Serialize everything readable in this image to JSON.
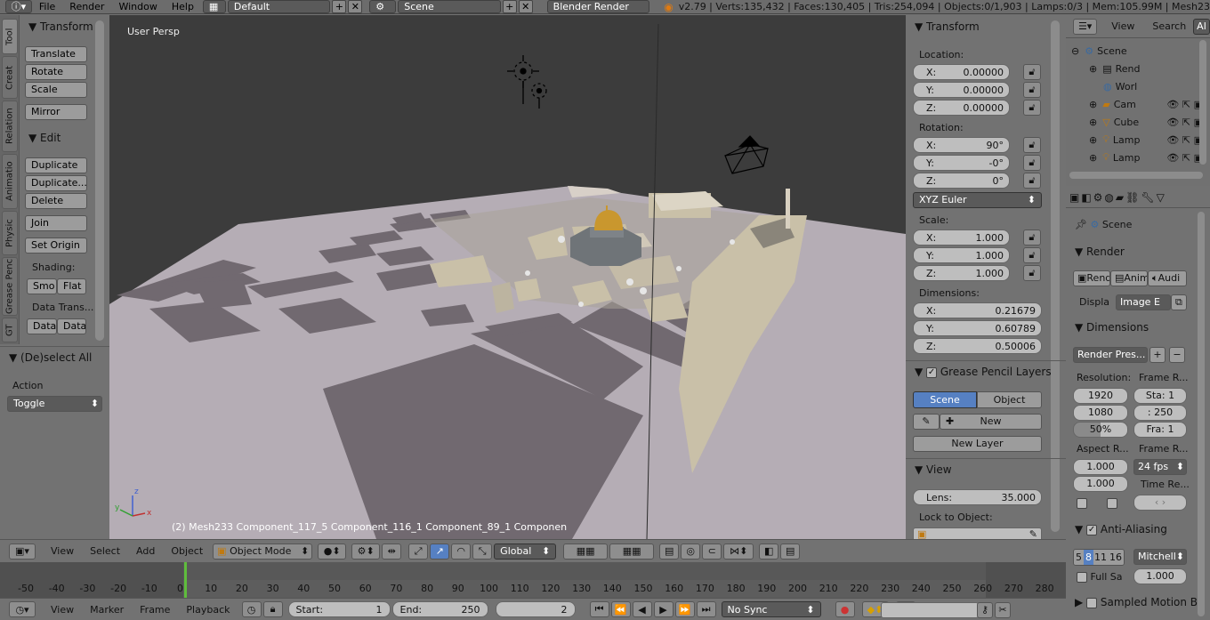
{
  "topbar": {
    "menus": [
      "File",
      "Render",
      "Window",
      "Help"
    ],
    "screen_layout": "Default",
    "scene": "Scene",
    "render_engine": "Blender Render",
    "stats": "v2.79 | Verts:135,432 | Faces:130,405 | Tris:254,094 | Objects:0/1,903 | Lamps:0/3 | Mem:105.99M | Mesh23"
  },
  "toolshelf": {
    "tabs": [
      "Tool",
      "Creat",
      "Relation",
      "Animatio",
      "Physic",
      "Grease Penc",
      "GT"
    ],
    "transform_header": "Transform",
    "translate": "Translate",
    "rotate": "Rotate",
    "scale": "Scale",
    "mirror": "Mirror",
    "edit_header": "Edit",
    "duplicate": "Duplicate",
    "duplicate_linked": "Duplicate...",
    "delete": "Delete",
    "join": "Join",
    "set_origin": "Set Origin",
    "shading_label": "Shading:",
    "smooth": "Smo",
    "flat": "Flat",
    "data_transfer_label": "Data Trans...",
    "data1": "Data",
    "data2": "Data",
    "deselect_header": "(De)select All",
    "action_label": "Action",
    "action_value": "Toggle"
  },
  "viewport": {
    "view_label": "User Persp",
    "object_info": "(2) Mesh233 Component_117_5 Component_116_1 Component_89_1 Componen"
  },
  "npanel": {
    "transform_header": "Transform",
    "location_label": "Location:",
    "loc_x": "0.00000",
    "loc_y": "0.00000",
    "loc_z": "0.00000",
    "rotation_label": "Rotation:",
    "rot_x": "90°",
    "rot_y": "-0°",
    "rot_z": "0°",
    "rotation_mode": "XYZ Euler",
    "scale_label": "Scale:",
    "scale_x": "1.000",
    "scale_y": "1.000",
    "scale_z": "1.000",
    "dimensions_label": "Dimensions:",
    "dim_x": "0.21679",
    "dim_y": "0.60789",
    "dim_z": "0.50006",
    "grease_header": "Grease Pencil Layers",
    "scene_tab": "Scene",
    "object_tab": "Object",
    "new_label": "New",
    "new_layer": "New Layer",
    "view_header": "View",
    "lens_label": "Lens:",
    "lens_value": "35.000",
    "lock_label": "Lock to Object:",
    "axis_x": "X:",
    "axis_y": "Y:",
    "axis_z": "Z:"
  },
  "outliner": {
    "view": "View",
    "search": "Search",
    "all": "Al",
    "items": [
      "Scene",
      "Rend",
      "Worl",
      "Cam",
      "Cube",
      "Lamp",
      "Lamp"
    ]
  },
  "properties": {
    "breadcrumb": "Scene",
    "render_header": "Render",
    "render_btn": "Rend",
    "anim_btn": "Anim",
    "audio_btn": "Audi",
    "display_label": "Displa",
    "display_value": "Image E",
    "dimensions_header": "Dimensions",
    "preset": "Render Pres...",
    "resolution_label": "Resolution:",
    "frame_range_label": "Frame R...",
    "res_x": "1920",
    "res_y": "1080",
    "res_pct": "50%",
    "start": "Sta: 1",
    "end": ": 250",
    "frame": "Fra: 1",
    "aspect_label": "Aspect R...",
    "framerate_label": "Frame R...",
    "aspect_x": "1.000",
    "aspect_y": "1.000",
    "fps": "24 fps",
    "time_remap_label": "Time Re...",
    "aa_header": "Anti-Aliasing",
    "aa_samples": [
      "5",
      "8",
      "11",
      "16"
    ],
    "filter": "Mitchell",
    "full_sample": "Full Sa",
    "filter_size": "1.000",
    "motion_blur": "Sampled Motion B"
  },
  "view_header": {
    "menus": [
      "View",
      "Select",
      "Add",
      "Object"
    ],
    "mode": "Object Mode",
    "orientation": "Global"
  },
  "timeline": {
    "ticks": [
      "-50",
      "-40",
      "-30",
      "-20",
      "-10",
      "0",
      "10",
      "20",
      "30",
      "40",
      "50",
      "60",
      "70",
      "80",
      "90",
      "100",
      "110",
      "120",
      "130",
      "140",
      "150",
      "160",
      "170",
      "180",
      "190",
      "200",
      "210",
      "220",
      "230",
      "240",
      "250",
      "260",
      "270",
      "280"
    ],
    "current_frame": 2
  },
  "timeline_header": {
    "menus": [
      "View",
      "Marker",
      "Frame",
      "Playback"
    ],
    "start_label": "Start:",
    "start_value": "1",
    "end_label": "End:",
    "end_value": "250",
    "current": "2",
    "sync": "No Sync"
  },
  "colors": {
    "panel": "#727272",
    "viewport_sky": "#3c3c3c",
    "ground": "#b5adb5",
    "blocks": "#716970",
    "accent_blue": "#5680c2",
    "dome": "#c9972e"
  }
}
